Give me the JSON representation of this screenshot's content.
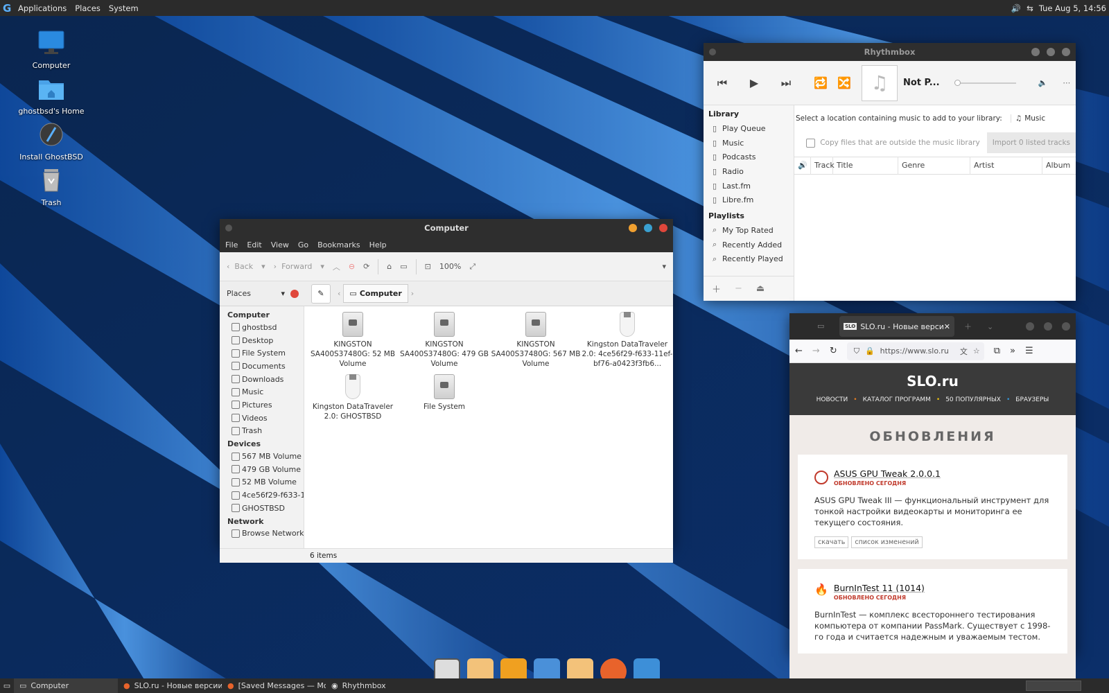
{
  "top_panel": {
    "menus": [
      "Applications",
      "Places",
      "System"
    ],
    "datetime": "Tue Aug 5, 14:56"
  },
  "desktop_icons": [
    "Computer",
    "ghostbsd's Home",
    "Install GhostBSD",
    "Trash"
  ],
  "file_manager": {
    "title": "Computer",
    "menu": [
      "File",
      "Edit",
      "View",
      "Go",
      "Bookmarks",
      "Help"
    ],
    "toolbar": {
      "back": "Back",
      "forward": "Forward",
      "zoom": "100%"
    },
    "places_label": "Places",
    "path_current": "Computer",
    "sidebar": {
      "computer_header": "Computer",
      "computer_items": [
        "ghostbsd",
        "Desktop",
        "File System",
        "Documents",
        "Downloads",
        "Music",
        "Pictures",
        "Videos",
        "Trash"
      ],
      "devices_header": "Devices",
      "device_items": [
        "567 MB Volume",
        "479 GB Volume",
        "52 MB Volume",
        "4ce56f29-f633-1...",
        "GHOSTBSD"
      ],
      "network_header": "Network",
      "network_items": [
        "Browse Network"
      ]
    },
    "items": [
      {
        "label": "KINGSTON SA400S37480G: 52 MB Volume",
        "kind": "drive"
      },
      {
        "label": "KINGSTON SA400S37480G: 479 GB Volume",
        "kind": "drive"
      },
      {
        "label": "KINGSTON SA400S37480G: 567 MB Volume",
        "kind": "drive"
      },
      {
        "label": "Kingston DataTraveler 2.0: 4ce56f29-f633-11ef-bf76-a0423f3fb6...",
        "kind": "usb"
      },
      {
        "label": "Kingston DataTraveler 2.0: GHOSTBSD",
        "kind": "usb"
      },
      {
        "label": "File System",
        "kind": "drive"
      }
    ],
    "status": "6 items"
  },
  "rhythmbox": {
    "title": "Rhythmbox",
    "now_playing": "Not P...",
    "library_header": "Library",
    "library_items": [
      "Play Queue",
      "Music",
      "Podcasts",
      "Radio",
      "Last.fm",
      "Libre.fm"
    ],
    "playlists_header": "Playlists",
    "playlist_items": [
      "My Top Rated",
      "Recently Added",
      "Recently Played"
    ],
    "import_prompt": "Select a location containing music to add to your library:",
    "location": "Music",
    "copy_label": "Copy files that are outside the music library",
    "import_button": "Import 0 listed tracks",
    "columns": [
      "Track",
      "Title",
      "Genre",
      "Artist",
      "Album"
    ]
  },
  "browser": {
    "tab_title": "SLO.ru - Новые версии п",
    "tab_badge": "SLO",
    "url": "https://www.slo.ru",
    "site_logo": "SLO.ru",
    "site_nav": [
      "НОВОСТИ",
      "КАТАЛОГ ПРОГРАММ",
      "50 ПОПУЛЯРНЫХ",
      "БРАУЗЕРЫ"
    ],
    "section_title": "ОБНОВЛЕНИЯ",
    "cards": [
      {
        "title": "ASUS GPU Tweak 2.0.0.1",
        "updated": "ОБНОВЛЕНО СЕГОДНЯ",
        "desc": "ASUS GPU Tweak III — функциональный инструмент для тонкой настройки видеокарты и мониторинга ее текущего состояния.",
        "tags": [
          "скачать",
          "список изменений"
        ]
      },
      {
        "title": "BurnInTest 11 (1014)",
        "updated": "ОБНОВЛЕНО СЕГОДНЯ",
        "desc": "BurnInTest — комплекс всестороннего тестирования компьютера от компании PassMark. Существует с 1998-го года и считается надежным и уважаемым тестом.",
        "tags": []
      }
    ]
  },
  "taskbar": {
    "tasks": [
      "Computer",
      "SLO.ru - Новые версии ...",
      "[Saved Messages — Mo...",
      "Rhythmbox"
    ]
  },
  "colors": {
    "min_btn": "#f0a030",
    "max_btn": "#3aa0d0",
    "close_btn": "#e0473b",
    "accent": "#c0392b"
  }
}
